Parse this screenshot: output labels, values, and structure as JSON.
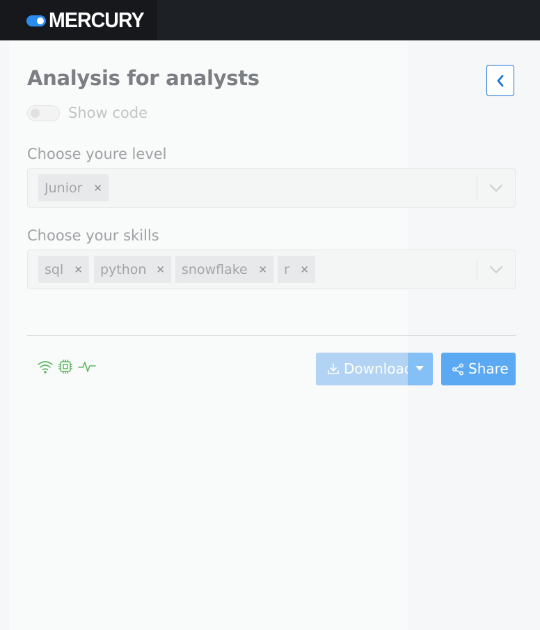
{
  "app": {
    "brand": "MERCURY"
  },
  "sidebar": {
    "title": "Analysis for analysts",
    "show_code_label": "Show code",
    "show_code_enabled": false,
    "level_field": {
      "label": "Choose youre level",
      "selected": [
        "Junior"
      ]
    },
    "skills_field": {
      "label": "Choose your skills",
      "selected": [
        "sql",
        "python",
        "snowflake",
        "r"
      ]
    },
    "status_icons": [
      "wifi-icon",
      "cpu-icon",
      "activity-icon"
    ],
    "download_label": "Download",
    "share_label": "Share"
  },
  "colors": {
    "accent": "#1a73d9",
    "status_green": "#4caf50",
    "topbar": "#1d2025"
  }
}
